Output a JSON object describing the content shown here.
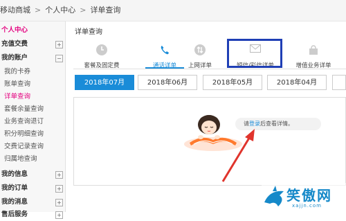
{
  "breadcrumb": {
    "items": [
      "移动商城",
      "个人中心",
      "详单查询"
    ],
    "separator": ">"
  },
  "sidebar": {
    "items": [
      {
        "label": "个人中心"
      },
      {
        "label": "充值交费",
        "plus": "+"
      },
      {
        "label": "我的账户",
        "plus": "−"
      },
      {
        "label": "我的卡券"
      },
      {
        "label": "账单查询"
      },
      {
        "label": "详单查询"
      },
      {
        "label": "套餐余量查询"
      },
      {
        "label": "业务查询退订"
      },
      {
        "label": "积分明细查询"
      },
      {
        "label": "交费记录查询"
      },
      {
        "label": "归属地查询"
      },
      {
        "label": "我的信息",
        "plus": "+"
      },
      {
        "label": "我的订单",
        "plus": "+"
      },
      {
        "label": "我的消息",
        "plus": "+"
      },
      {
        "label": "售后服务",
        "plus": "+"
      }
    ]
  },
  "main": {
    "title": "详单查询",
    "tabs": [
      {
        "label": "套餐及固定费",
        "icon": "clock-icon"
      },
      {
        "label": "通话详单",
        "icon": "phone-icon"
      },
      {
        "label": "上网详单",
        "icon": "data-arrows-icon"
      },
      {
        "label": "短信/彩信详单",
        "icon": "envelope-icon"
      },
      {
        "label": "增值业务详单",
        "icon": "bag-icon"
      }
    ],
    "months": [
      "2018年07月",
      "2018年06月",
      "2018年05月",
      "2018年04月"
    ],
    "login_prompt": {
      "prefix": "请",
      "link": "登录",
      "suffix": "后查看详情。"
    }
  },
  "watermark": {
    "text": "笑傲网",
    "url": "xajjn.com"
  },
  "colors": {
    "accent": "#1a8cd8",
    "brand": "#e4007f",
    "highlight": "#1f3fb5",
    "arrow": "#e0342c"
  }
}
